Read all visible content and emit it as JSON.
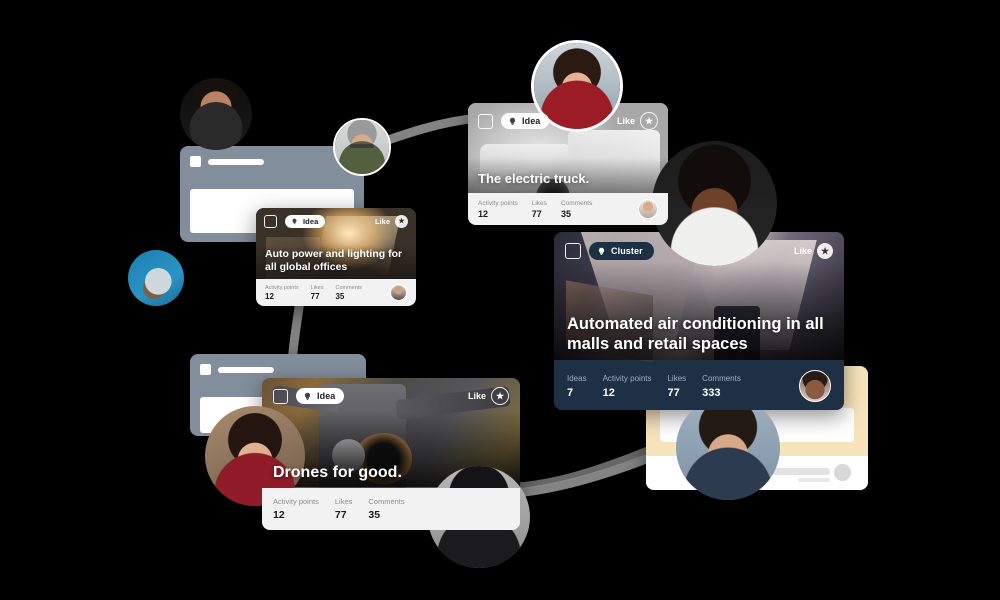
{
  "scene": {
    "title": "Idea collaboration board collage",
    "background": "#000000",
    "connector_color": "#8a8a8a"
  },
  "labels": {
    "like": "Like",
    "activity_points": "Activity points",
    "likes": "Likes",
    "comments": "Comments",
    "ideas": "Ideas"
  },
  "cards": {
    "truck": {
      "badge": "Idea",
      "badge_icon": "lightbulb-icon",
      "like_label": "Like",
      "title": "The electric truck.",
      "stats": [
        {
          "key": "Activity points",
          "value": "12"
        },
        {
          "key": "Likes",
          "value": "77"
        },
        {
          "key": "Comments",
          "value": "35"
        }
      ]
    },
    "lighting": {
      "badge": "Idea",
      "badge_icon": "lightbulb-icon",
      "like_label": "Like",
      "title": "Auto power and lighting for all global offices",
      "stats": [
        {
          "key": "Activity points",
          "value": "12"
        },
        {
          "key": "Likes",
          "value": "77"
        },
        {
          "key": "Comments",
          "value": "35"
        }
      ]
    },
    "cluster": {
      "badge": "Cluster",
      "badge_icon": "lightbulb-icon",
      "like_label": "Like",
      "title": "Automated air conditioning in all malls and retail spaces",
      "accent": "#1d3044",
      "stats": [
        {
          "key": "Ideas",
          "value": "7"
        },
        {
          "key": "Activity points",
          "value": "12"
        },
        {
          "key": "Likes",
          "value": "77"
        },
        {
          "key": "Comments",
          "value": "333"
        }
      ]
    },
    "drones": {
      "badge": "Idea",
      "badge_icon": "lightbulb-icon",
      "like_label": "Like",
      "title": "Drones for good.",
      "stats": [
        {
          "key": "Activity points",
          "value": "12"
        },
        {
          "key": "Likes",
          "value": "77"
        },
        {
          "key": "Comments",
          "value": "35"
        }
      ]
    }
  },
  "wireframes": {
    "top_left": {
      "name": "placeholder-card"
    },
    "bottom_left": {
      "name": "placeholder-card"
    },
    "right_cream": {
      "name": "cream-placeholder-card",
      "color": "#f8e4bc"
    }
  },
  "avatars": [
    {
      "name": "avatar-bearded-man"
    },
    {
      "name": "avatar-man-glasses"
    },
    {
      "name": "avatar-woman-red-top"
    },
    {
      "name": "avatar-person-hoodie"
    },
    {
      "name": "avatar-smiling-woman"
    },
    {
      "name": "avatar-woman-dark-hair"
    },
    {
      "name": "avatar-man-beanie"
    },
    {
      "name": "avatar-man-suit"
    }
  ]
}
